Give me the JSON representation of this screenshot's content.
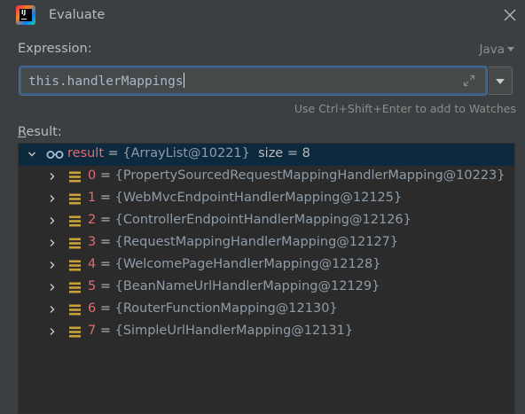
{
  "window": {
    "title": "Evaluate"
  },
  "expression": {
    "label": "Expression:",
    "language": "Java",
    "value": "this.handlerMappings",
    "hint": "Use Ctrl+Shift+Enter to add to Watches"
  },
  "result": {
    "label_underlined": "R",
    "label_rest": "esult:",
    "root": {
      "name": "result",
      "equals": " = ",
      "value": "{ArrayList@10221}",
      "size": "size = 8"
    },
    "items": [
      {
        "index": "0",
        "equals": " = ",
        "value": "{PropertySourcedRequestMappingHandlerMapping@10223}"
      },
      {
        "index": "1",
        "equals": " = ",
        "value": "{WebMvcEndpointHandlerMapping@12125}"
      },
      {
        "index": "2",
        "equals": " = ",
        "value": "{ControllerEndpointHandlerMapping@12126}"
      },
      {
        "index": "3",
        "equals": " = ",
        "value": "{RequestMappingHandlerMapping@12127}"
      },
      {
        "index": "4",
        "equals": " = ",
        "value": "{WelcomePageHandlerMapping@12128}"
      },
      {
        "index": "5",
        "equals": " = ",
        "value": "{BeanNameUrlHandlerMapping@12129}"
      },
      {
        "index": "6",
        "equals": " = ",
        "value": "{RouterFunctionMapping@12130}"
      },
      {
        "index": "7",
        "equals": " = ",
        "value": "{SimpleUrlHandlerMapping@12131}"
      }
    ]
  },
  "colors": {
    "selection": "#0d293e",
    "focus_border": "#3d6185",
    "field_icon": "#c9a13a",
    "watch_icon": "#a4bfd6"
  }
}
